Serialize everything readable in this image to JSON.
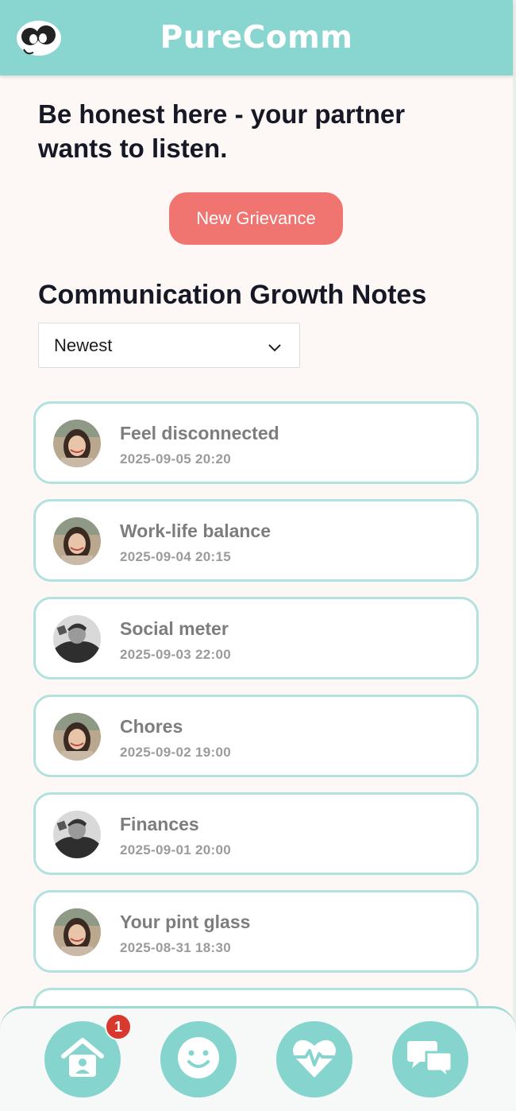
{
  "app": {
    "title": "PureComm"
  },
  "prompt": "Be honest here - your partner wants to listen.",
  "new_grievance_label": "New Grievance",
  "section_title": "Communication Growth Notes",
  "sort": {
    "selected": "Newest"
  },
  "notes": [
    {
      "title": "Feel disconnected",
      "date": "2025-09-05 20:20",
      "author": "partner-a"
    },
    {
      "title": "Work-life balance",
      "date": "2025-09-04 20:15",
      "author": "partner-a"
    },
    {
      "title": "Social meter",
      "date": "2025-09-03 22:00",
      "author": "partner-b"
    },
    {
      "title": "Chores",
      "date": "2025-09-02 19:00",
      "author": "partner-a"
    },
    {
      "title": "Finances",
      "date": "2025-09-01 20:00",
      "author": "partner-b"
    },
    {
      "title": "Your pint glass",
      "date": "2025-08-31 18:30",
      "author": "partner-a"
    }
  ],
  "nav": {
    "home_badge": "1",
    "items": [
      "home-icon",
      "smile-icon",
      "heartbeat-icon",
      "chat-icon"
    ]
  },
  "colors": {
    "header": "#89d5cf",
    "accent_button": "#f07470",
    "card_border": "#b3e1de",
    "nav_button": "#86d4ce",
    "badge": "#d8392f"
  }
}
